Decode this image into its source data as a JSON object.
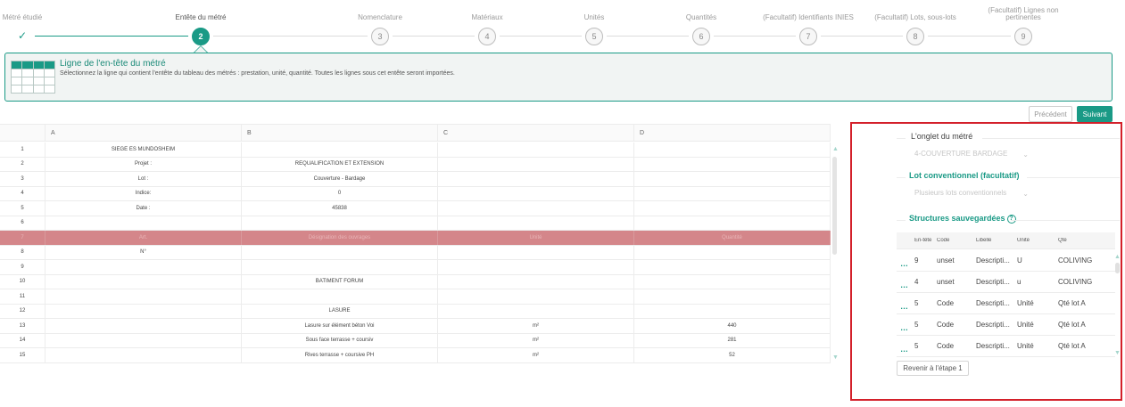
{
  "stepper": {
    "steps": [
      {
        "label": "Métré étudié",
        "number": "",
        "state": "done"
      },
      {
        "label": "Entête du métré",
        "number": "2",
        "state": "active"
      },
      {
        "label": "Nomenclature",
        "number": "3",
        "state": "todo"
      },
      {
        "label": "Matériaux",
        "number": "4",
        "state": "todo"
      },
      {
        "label": "Unités",
        "number": "5",
        "state": "todo"
      },
      {
        "label": "Quantités",
        "number": "6",
        "state": "todo"
      },
      {
        "label": "(Facultatif) Identifiants INIES",
        "number": "7",
        "state": "todo"
      },
      {
        "label": "(Facultatif) Lots, sous-lots",
        "number": "8",
        "state": "todo"
      },
      {
        "label": "(Facultatif) Lignes non pertinentes",
        "number": "9",
        "state": "todo"
      }
    ]
  },
  "info": {
    "title": "Ligne de l'en-tête du métré",
    "text": "Sélectionnez la ligne qui contient l'entête du tableau des métrés : prestation, unité, quantité. Toutes les lignes sous cet entête seront importées."
  },
  "nav": {
    "prev_label": "Précédent",
    "next_label": "Suivant"
  },
  "sheet": {
    "columns": [
      "",
      "A",
      "B",
      "C",
      "D"
    ],
    "selected_row": 7,
    "rows": [
      {
        "n": "1",
        "A": "SIEGE ES MUNDOSHEIM",
        "B": "",
        "C": "",
        "D": ""
      },
      {
        "n": "2",
        "A": "Projet :",
        "B": "REQUALIFICATION ET EXTENSION",
        "C": "",
        "D": ""
      },
      {
        "n": "3",
        "A": "Lot :",
        "B": "Couverture - Bardage",
        "C": "",
        "D": ""
      },
      {
        "n": "4",
        "A": "Indice:",
        "B": "0",
        "C": "",
        "D": ""
      },
      {
        "n": "5",
        "A": "Date :",
        "B": "45838",
        "C": "",
        "D": ""
      },
      {
        "n": "6",
        "A": "",
        "B": "",
        "C": "",
        "D": ""
      },
      {
        "n": "7",
        "A": "Art.",
        "B": "Désignation des ouvrages",
        "C": "Unité",
        "D": "Quantité"
      },
      {
        "n": "8",
        "A": "N°",
        "B": "",
        "C": "",
        "D": ""
      },
      {
        "n": "9",
        "A": "",
        "B": "",
        "C": "",
        "D": ""
      },
      {
        "n": "10",
        "A": "",
        "B": "BATIMENT FORUM",
        "C": "",
        "D": ""
      },
      {
        "n": "11",
        "A": "",
        "B": "",
        "C": "",
        "D": ""
      },
      {
        "n": "12",
        "A": "",
        "B": "LASURE",
        "C": "",
        "D": ""
      },
      {
        "n": "13",
        "A": "",
        "B": "Lasure sur élément béton Voi",
        "C": "m²",
        "D": "440"
      },
      {
        "n": "14",
        "A": "",
        "B": "Sous face terrasse + coursiv",
        "C": "m²",
        "D": "281"
      },
      {
        "n": "15",
        "A": "",
        "B": "Rives terrasse + coursive PH",
        "C": "m²",
        "D": "52"
      }
    ]
  },
  "panel": {
    "tab_title": "L'onglet du métré",
    "tab_value": "4-COUVERTURE BARDAGE",
    "lot_title": "Lot conventionnel (facultatif)",
    "lot_placeholder": "Plusieurs lots conventionnels",
    "saved_title": "Structures sauvegardées",
    "saved_columns": [
      "En-tête",
      "Code",
      "Libellé",
      "Unité",
      "Qté"
    ],
    "saved_rows": [
      {
        "entete": "9",
        "code": "unset",
        "libelle": "Descripti...",
        "unite": "U",
        "qte": "COLIVING"
      },
      {
        "entete": "4",
        "code": "unset",
        "libelle": "Descripti...",
        "unite": "u",
        "qte": "COLIVING"
      },
      {
        "entete": "5",
        "code": "Code",
        "libelle": "Descripti...",
        "unite": "Unité",
        "qte": "Qté lot A"
      },
      {
        "entete": "5",
        "code": "Code",
        "libelle": "Descripti...",
        "unite": "Unité",
        "qte": "Qté lot A"
      },
      {
        "entete": "5",
        "code": "Code",
        "libelle": "Descripti...",
        "unite": "Unité",
        "qte": "Qté lot A"
      }
    ],
    "back_label": "Revenir à l'étape 1"
  },
  "colors": {
    "accent": "#1a9a86",
    "selected_row": "#d4868a",
    "panel_border": "#d3202a"
  }
}
